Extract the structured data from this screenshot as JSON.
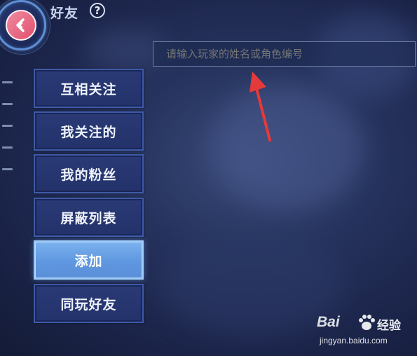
{
  "header": {
    "title": "好友",
    "help_label": "?",
    "back_icon": "back-chevron-icon"
  },
  "search": {
    "placeholder": "请输入玩家的姓名或角色编号",
    "value": ""
  },
  "menu": {
    "items": [
      {
        "label": "互相关注",
        "active": false
      },
      {
        "label": "我关注的",
        "active": false
      },
      {
        "label": "我的粉丝",
        "active": false
      },
      {
        "label": "屏蔽列表",
        "active": false
      },
      {
        "label": "添加",
        "active": true
      },
      {
        "label": "同玩好友",
        "active": false
      }
    ]
  },
  "watermark": {
    "logo": "Bai",
    "logo_suffix": "经验",
    "url": "jingyan.baidu.com"
  },
  "colors": {
    "accent_active": "#6aa4e8",
    "menu_bg": "#26356c",
    "annotation": "#e53a3a"
  }
}
